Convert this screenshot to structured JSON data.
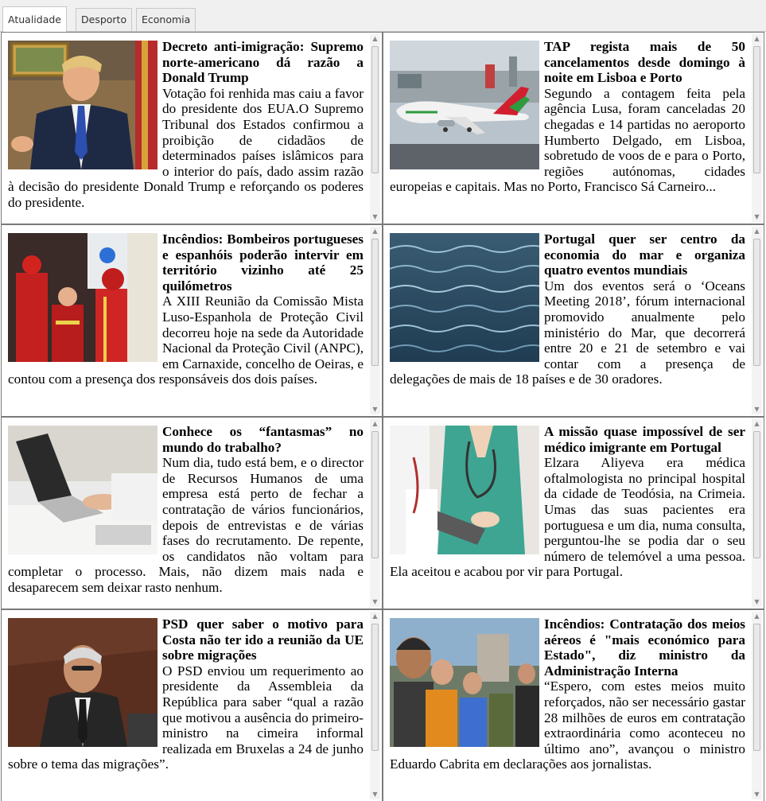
{
  "tabs": [
    {
      "label": "Atualidade",
      "active": true
    },
    {
      "label": "Desporto",
      "active": false
    },
    {
      "label": "Economia",
      "active": false
    }
  ],
  "articles": [
    {
      "headline": "Decreto anti-imigração: Supremo norte-americano dá razão a Donald Trump",
      "body": "Votação foi renhida mas caiu a favor do presidente dos EUA.O Supremo Tribunal dos Estados confirmou a proibição de cidadãos de determinados países islâmicos para o interior do país, dado assim razão à decisão do presidente Donald Trump e reforçando os poderes do presidente.",
      "image": "trump-photo"
    },
    {
      "headline": "TAP regista mais de 50 cancelamentos desde domingo à noite em Lisboa e Porto",
      "body": "Segundo a contagem feita pela agência Lusa, foram canceladas 20 chegadas e 14 partidas no aeroporto Humberto Delgado, em Lisboa, sobretudo de voos de e para o Porto, regiões autónomas, cidades europeias e capitais. Mas no Porto, Francisco Sá Carneiro...",
      "image": "airplane-photo"
    },
    {
      "headline": "Incêndios: Bombeiros portugueses e espanhóis poderão intervir em território vizinho até 25 quilómetros",
      "body": "A XIII Reunião da Comissão Mista Luso-Espanhola de Proteção Civil decorreu hoje na sede da Autoridade Nacional da Proteção Civil (ANPC), em Carnaxide, concelho de Oeiras, e contou com a presença dos responsáveis dos dois países.",
      "image": "firefighters-photo"
    },
    {
      "headline": "Portugal quer ser centro da economia do mar e organiza quatro eventos mundiais",
      "body": "Um dos eventos será o ‘Oceans Meeting 2018’, fórum internacional promovido anualmente pelo ministério do Mar, que decorrerá entre 20 e 21 de setembro e vai contar com a presença de delegações de mais de 18 países e de 30 oradores.",
      "image": "sea-photo"
    },
    {
      "headline": "Conhece os “fantasmas” no mundo do trabalho?",
      "body": "Num dia, tudo está bem, e o director de Recursos Humanos de uma empresa está perto de fechar a contratação de vários funcionários, depois de entrevistas e de várias fases do recrutamento. De repente, os candidatos não voltam para completar o processo. Mais, não dizem mais nada e desaparecem sem deixar rasto nenhum.",
      "image": "laptop-photo"
    },
    {
      "headline": "A missão quase impossível de ser médico imigrante em Portugal",
      "body": "Elzara Aliyeva era médica oftalmologista no principal hospital da cidade de Teodósia, na Crimeia. Umas das suas pacientes era portuguesa e um dia, numa consulta, perguntou-lhe se podia dar o seu número de telemóvel a uma pessoa. Ela aceitou e acabou por vir para Portugal.",
      "image": "doctor-photo"
    },
    {
      "headline": "PSD quer saber o motivo para Costa não ter ido a reunião da UE sobre migrações",
      "body": "O PSD enviou um requerimento ao presidente da Assembleia da República para saber “qual a razão que motivou a ausência do primeiro-ministro na cimeira informal realizada em Bruxelas a 24 de junho sobre o tema das migrações”.",
      "image": "costa-photo"
    },
    {
      "headline": "Incêndios: Contratação dos meios aéreos é \"mais económico para Estado\", diz ministro da Administração Interna",
      "body": "“Espero, com estes meios muito reforçados, não ser necessário gastar 28 milhões de euros em contratação extraordinária como aconteceu no último ano”, avançou o ministro Eduardo Cabrita em declarações aos jornalistas.",
      "image": "ministers-photo"
    }
  ]
}
